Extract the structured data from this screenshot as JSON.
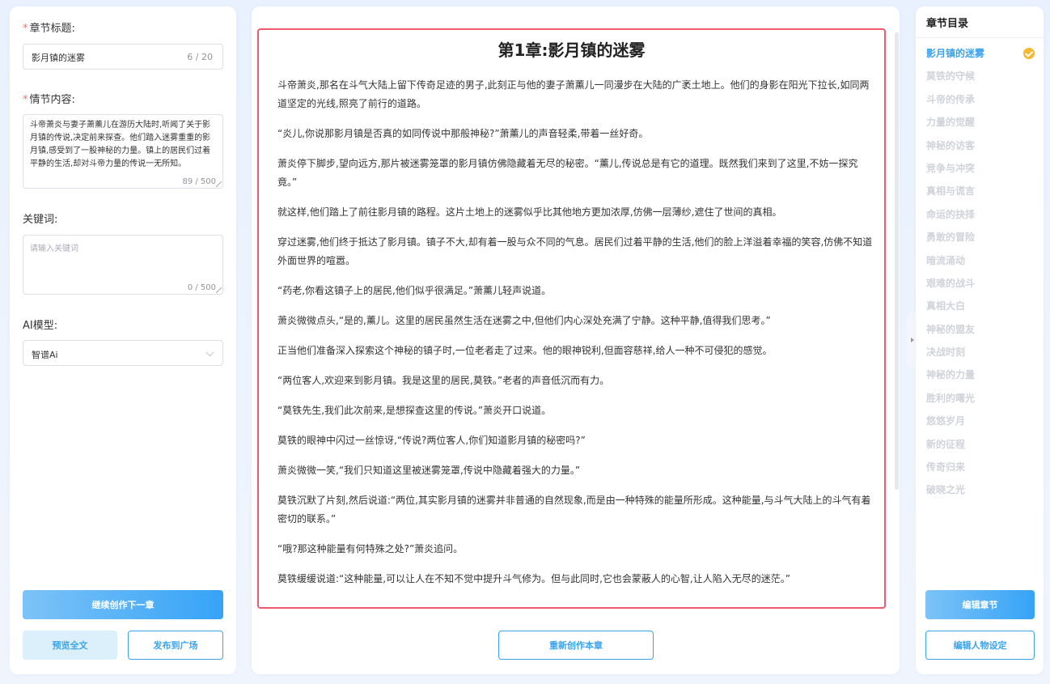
{
  "left": {
    "chapter_title_label": "章节标题:",
    "chapter_title_value": "影月镇的迷雾",
    "chapter_title_counter": "6 / 20",
    "plot_label": "情节内容:",
    "plot_value": "斗帝萧炎与妻子萧薰儿在游历大陆时,听闻了关于影月镇的传说,决定前来探查。他们踏入迷雾重重的影月镇,感受到了一股神秘的力量。镇上的居民们过着平静的生活,却对斗帝力量的传说一无所知。",
    "plot_counter": "89 / 500",
    "keywords_label": "关键词:",
    "keywords_placeholder": "请输入关键词",
    "keywords_counter": "0 / 500",
    "model_label": "AI模型:",
    "model_value": "智谱Ai",
    "continue_button": "继续创作下一章",
    "preview_button": "预览全文",
    "publish_button": "发布到广场"
  },
  "center": {
    "chapter_heading": "第1章:影月镇的迷雾",
    "paragraphs": [
      "斗帝萧炎,那名在斗气大陆上留下传奇足迹的男子,此刻正与他的妻子萧薰儿一同漫步在大陆的广袤土地上。他们的身影在阳光下拉长,如同两道坚定的光线,照亮了前行的道路。",
      "“炎儿,你说那影月镇是否真的如同传说中那般神秘?”萧薰儿的声音轻柔,带着一丝好奇。",
      "萧炎停下脚步,望向远方,那片被迷雾笼罩的影月镇仿佛隐藏着无尽的秘密。“薰儿,传说总是有它的道理。既然我们来到了这里,不妨一探究竟。”",
      "就这样,他们踏上了前往影月镇的路程。这片土地上的迷雾似乎比其他地方更加浓厚,仿佛一层薄纱,遮住了世间的真相。",
      "穿过迷雾,他们终于抵达了影月镇。镇子不大,却有着一股与众不同的气息。居民们过着平静的生活,他们的脸上洋溢着幸福的笑容,仿佛不知道外面世界的喧嚣。",
      "“药老,你看这镇子上的居民,他们似乎很满足。”萧薰儿轻声说道。",
      "萧炎微微点头,“是的,薰儿。这里的居民虽然生活在迷雾之中,但他们内心深处充满了宁静。这种平静,值得我们思考。”",
      "正当他们准备深入探索这个神秘的镇子时,一位老者走了过来。他的眼神锐利,但面容慈祥,给人一种不可侵犯的感觉。",
      "“两位客人,欢迎来到影月镇。我是这里的居民,莫铁。”老者的声音低沉而有力。",
      "“莫铁先生,我们此次前来,是想探查这里的传说。”萧炎开口说道。",
      "莫铁的眼神中闪过一丝惊讶,“传说?两位客人,你们知道影月镇的秘密吗?”",
      "萧炎微微一笑,“我们只知道这里被迷雾笼罩,传说中隐藏着强大的力量。”",
      "莫铁沉默了片刻,然后说道:“两位,其实影月镇的迷雾并非普通的自然现象,而是由一种特殊的能量所形成。这种能量,与斗气大陆上的斗气有着密切的联系。”",
      "“哦?那这种能量有何特殊之处?”萧炎追问。",
      "莫铁缓缓说道:“这种能量,可以让人在不知不觉中提升斗气修为。但与此同时,它也会蒙蔽人的心智,让人陷入无尽的迷茫。”"
    ],
    "recreate_button": "重新创作本章"
  },
  "right": {
    "toc_title": "章节目录",
    "chapters": [
      "影月镇的迷雾",
      "莫铁的守候",
      "斗帝的传承",
      "力量的觉醒",
      "神秘的访客",
      "竞争与冲突",
      "真相与谎言",
      "命运的抉择",
      "勇敢的冒险",
      "暗流涌动",
      "艰难的战斗",
      "真相大白",
      "神秘的盟友",
      "决战时刻",
      "神秘的力量",
      "胜利的曙光",
      "悠悠岁月",
      "新的征程",
      "传奇归来",
      "破晓之光"
    ],
    "edit_chapter_button": "编辑章节",
    "edit_character_button": "编辑人物设定"
  },
  "colors": {
    "accent": "#3da3ea",
    "highlight_border": "#f0596f",
    "check": "#f5b82e"
  }
}
